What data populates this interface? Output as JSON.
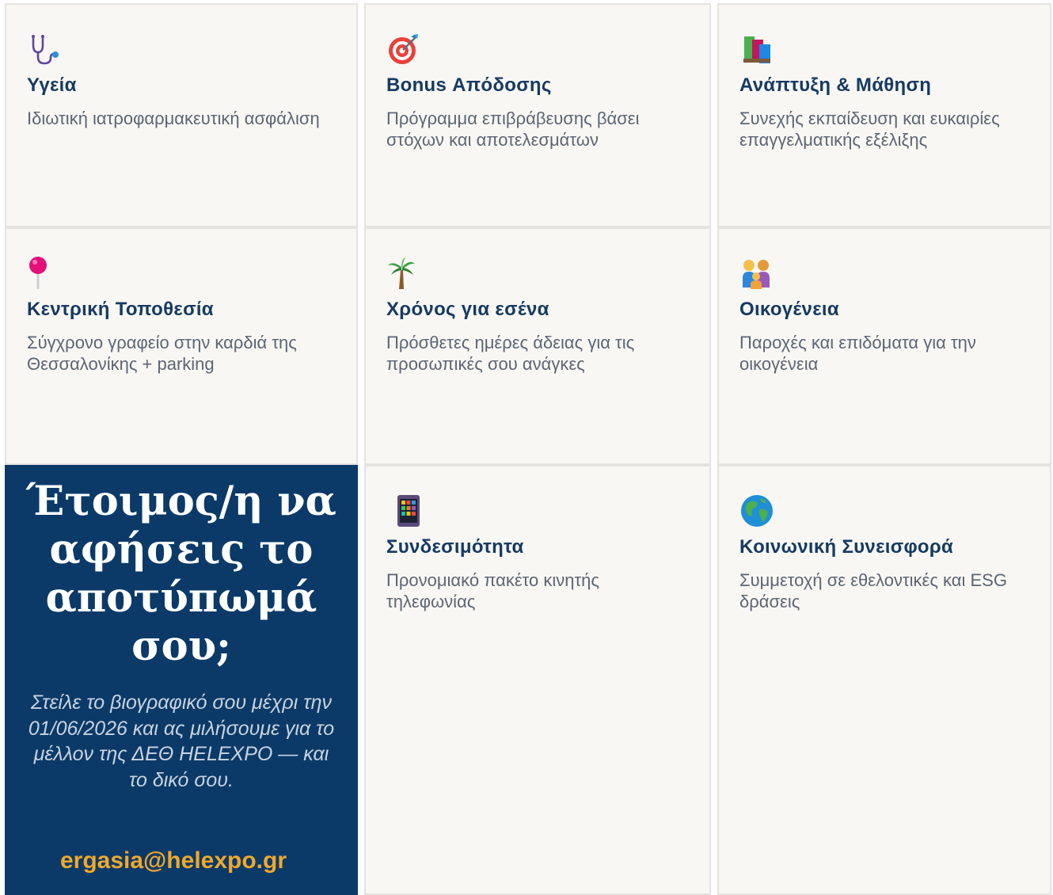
{
  "benefits": [
    {
      "title": "Υγεία",
      "description": "Ιδιωτική ιατροφαρμακευτική ασφάλιση",
      "icon": "stethoscope-icon"
    },
    {
      "title": "Bonus Απόδοσης",
      "description": "Πρόγραμμα επιβράβευσης βάσει στόχων και αποτελεσμάτων",
      "icon": "target-icon"
    },
    {
      "title": "Ανάπτυξη & Μάθηση",
      "description": "Συνεχής εκπαίδευση και ευκαιρίες επαγγελματικής εξέλιξης",
      "icon": "books-icon"
    },
    {
      "title": "Κεντρική Τοποθεσία",
      "description": "Σύγχρονο γραφείο στην καρδιά της Θεσσαλονίκης + parking",
      "icon": "pushpin-icon"
    },
    {
      "title": "Χρόνος για εσένα",
      "description": "Πρόσθετες ημέρες άδειας για τις προσωπικές σου ανάγκες",
      "icon": "palm-tree-icon"
    },
    {
      "title": "Οικογένεια",
      "description": "Παροχές και επιδόματα για την οικογένεια",
      "icon": "family-icon"
    },
    {
      "title": "Συνδεσιμότητα",
      "description": "Προνομιακό πακέτο κινητής τηλεφωνίας",
      "icon": "mobile-phone-icon"
    },
    {
      "title": "Κοινωνική Συνεισφορά",
      "description": "Συμμετοχή σε εθελοντικές και ESG δράσεις",
      "icon": "globe-icon"
    }
  ],
  "cta": {
    "heading": "Έτοιμος/η να αφήσεις το αποτύπωμά σου;",
    "body": "Στείλε το βιογραφικό σου μέχρι την 01/06/2026 και ας μιλήσουμε για το μέλλον της ΔΕΘ HELEXPO — και το δικό σου.",
    "email": "ergasia@helexpo.gr"
  },
  "colors": {
    "card_background": "#f8f7f3",
    "title": "#163a63",
    "description": "#5d6574",
    "cta_background": "#0b3a68",
    "cta_email": "#efa82d"
  }
}
